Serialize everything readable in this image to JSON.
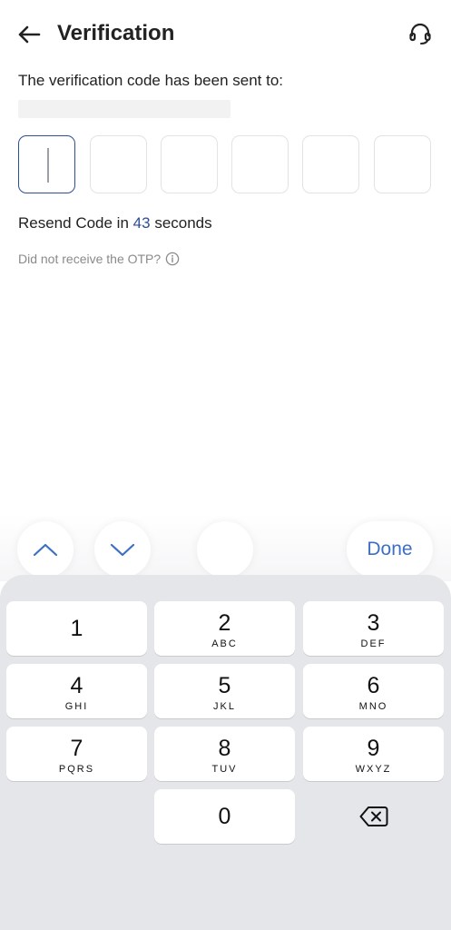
{
  "header": {
    "title": "Verification",
    "back_icon": "arrow-left-icon",
    "support_icon": "headset-icon"
  },
  "main": {
    "sent_to_label": "The verification code has been sent to:",
    "resend_prefix": "Resend Code in",
    "resend_seconds": "43",
    "resend_suffix": "seconds",
    "no_otp_label": "Did not receive the OTP?",
    "accent_color": "#2f4e93"
  },
  "accessory": {
    "done_label": "Done",
    "up_icon": "chevron-up-icon",
    "down_icon": "chevron-down-icon"
  },
  "keyboard": {
    "keys": [
      {
        "digit": "1",
        "letters": ""
      },
      {
        "digit": "2",
        "letters": "ABC"
      },
      {
        "digit": "3",
        "letters": "DEF"
      },
      {
        "digit": "4",
        "letters": "GHI"
      },
      {
        "digit": "5",
        "letters": "JKL"
      },
      {
        "digit": "6",
        "letters": "MNO"
      },
      {
        "digit": "7",
        "letters": "PQRS"
      },
      {
        "digit": "8",
        "letters": "TUV"
      },
      {
        "digit": "9",
        "letters": "WXYZ"
      },
      {
        "digit": "0",
        "letters": ""
      }
    ],
    "backspace_icon": "backspace-icon"
  }
}
